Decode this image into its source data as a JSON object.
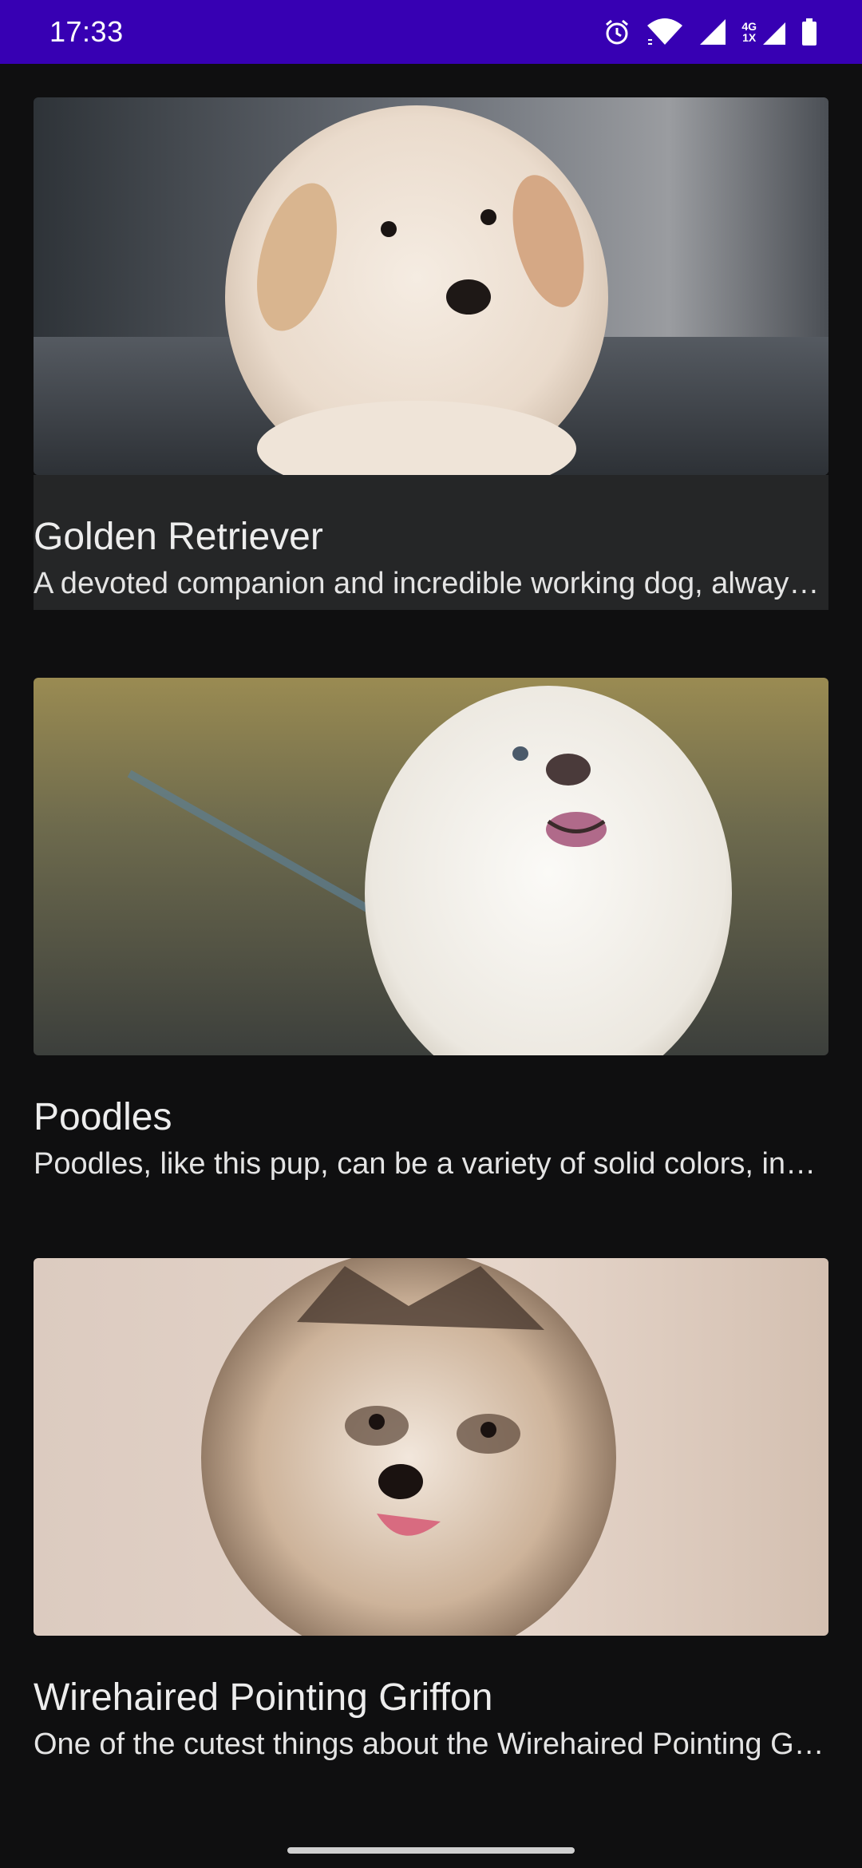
{
  "status_bar": {
    "time": "17:33",
    "network_top": "4G",
    "network_bottom": "1X",
    "icons": [
      "alarm-icon",
      "wifi-icon",
      "signal-icon",
      "signal-secondary-icon",
      "battery-icon"
    ]
  },
  "dogs": [
    {
      "title": "Golden Retriever",
      "description": "A devoted companion and incredible working dog, always eager to please and learn new things."
    },
    {
      "title": "Poodles",
      "description": "Poodles, like this pup, can be a variety of solid colors, including white, black and apricot."
    },
    {
      "title": "Wirehaired Pointing Griffon",
      "description": "One of the cutest things about the Wirehaired Pointing Griffon is its expressive face."
    }
  ],
  "colors": {
    "status_bar": "#3700b3",
    "background": "#0f0f10",
    "selected_card": "#252627"
  }
}
